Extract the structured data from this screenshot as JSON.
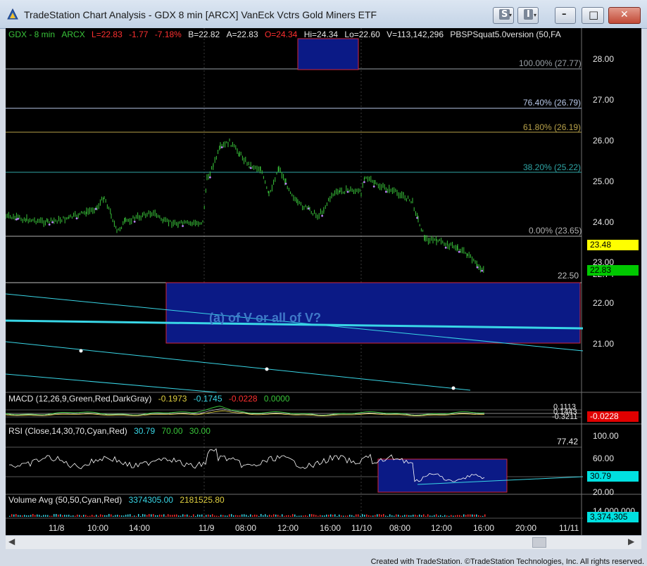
{
  "window": {
    "title": "TradeStation Chart Analysis - GDX 8 min [ARCX] VanEck Vctrs Gold Miners ETF",
    "btn_s": "S",
    "btn_i": "I",
    "btn_min": "–",
    "btn_max": "□",
    "btn_close": "✕"
  },
  "header": {
    "symbol": "GDX - 8 min",
    "exchange": "ARCX",
    "last": "L=22.83",
    "chg": "-1.77",
    "pct": "-7.18%",
    "bid": "B=22.82",
    "ask": "A=22.83",
    "open": "O=24.34",
    "hi": "Hi=24.34",
    "lo": "Lo=22.60",
    "vol": "V=113,142,296",
    "study": "PBSPSquat5.0version (50,FA"
  },
  "fib_levels": [
    {
      "label": "100.00% (27.77)",
      "color": "#9aa0a6"
    },
    {
      "label": "76.40% (26.79)",
      "color": "#b8c8e8"
    },
    {
      "label": "61.80% (26.19)",
      "color": "#b8a24a"
    },
    {
      "label": "38.20% (25.22)",
      "color": "#2fa6a6"
    },
    {
      "label": "0.00% (23.65)",
      "color": "#b0b0b0"
    }
  ],
  "level_2250": "22.50",
  "annotation": "(a) of V or all of V?",
  "price_axis": [
    "28.00",
    "27.00",
    "26.00",
    "25.00",
    "24.00",
    "23.00",
    "22.00",
    "21.00"
  ],
  "price_tags": {
    "yellow": "23.48",
    "green": "22.83",
    "behind": "22.74"
  },
  "macd": {
    "title": "MACD (12,26,9,Green,Red,DarkGray)",
    "v1": "-0.1973",
    "v2": "-0.1745",
    "v3": "-0.0228",
    "v4": "0.0000",
    "axis_a": "0.1113",
    "axis_b": "0.1443",
    "axis_c": "-0.3211",
    "tag": "-0.0228"
  },
  "rsi": {
    "title": "RSI (Close,14,30,70,Cyan,Red)",
    "v1": "30.79",
    "v2": "70.00",
    "v3": "30.00",
    "axis": [
      "100.00",
      "77.42",
      "60.00",
      "20.00"
    ],
    "tag": "30.79"
  },
  "volume": {
    "title": "Volume Avg (50,50,Cyan,Red)",
    "v1": "3374305.00",
    "v2": "2181525.80",
    "axis": "14,000,000",
    "tag": "3,374,305"
  },
  "time_axis": [
    "11/8",
    "10:00",
    "14:00",
    "11/9",
    "08:00",
    "12:00",
    "16:00",
    "11/10",
    "08:00",
    "12:00",
    "16:00",
    "20:00",
    "11/11"
  ],
  "footer": "Created with TradeStation. ©TradeStation Technologies, Inc. All rights reserved.",
  "colors": {
    "box_fill": "#0b1a86",
    "box_border": "#d0263a",
    "cyan": "#39d6e6",
    "bar_green": "#39c43a"
  }
}
